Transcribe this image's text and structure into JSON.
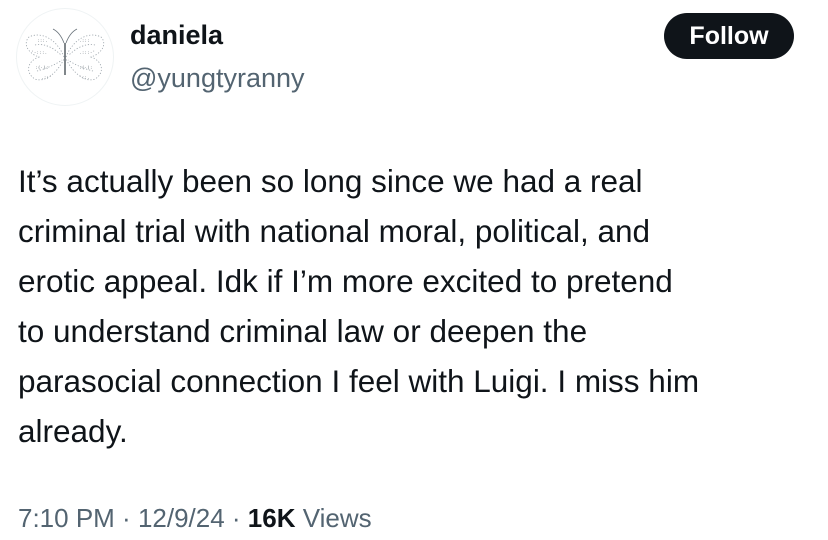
{
  "user": {
    "display_name": "daniela",
    "handle": "@yungtyranny"
  },
  "follow_button": {
    "label": "Follow"
  },
  "tweet": {
    "lines": [
      "It’s actually been so long since we had a real",
      "criminal trial with national moral, political, and",
      "erotic appeal. Idk if I’m more excited to pretend",
      "to understand criminal law or deepen the",
      "parasocial connection I feel with Luigi. I miss him",
      "already."
    ]
  },
  "meta": {
    "time": "7:10 PM",
    "separator": " · ",
    "date": "12/9/24",
    "views_count": "16K",
    "views_label": " Views"
  },
  "colors": {
    "text_primary": "#0f1419",
    "text_secondary": "#536471",
    "button_bg": "#0f1419",
    "button_text": "#ffffff"
  },
  "icons": {
    "avatar": "butterfly-text-art-avatar"
  }
}
